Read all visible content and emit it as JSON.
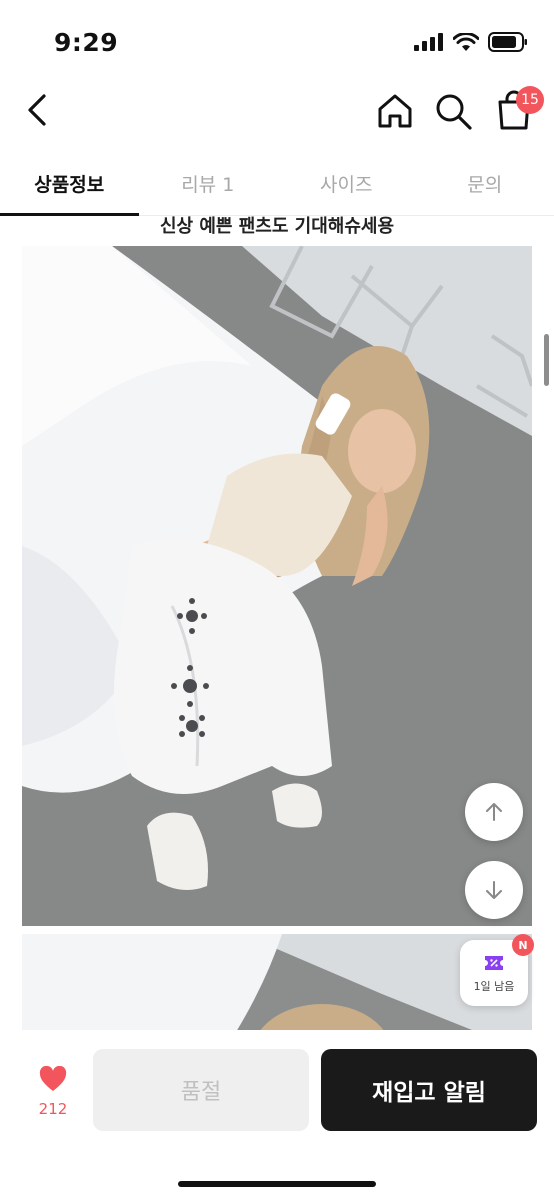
{
  "status": {
    "time": "9:29"
  },
  "nav": {
    "cart_badge": "15"
  },
  "tabs": [
    {
      "label": "상품정보"
    },
    {
      "label": "리뷰 1"
    },
    {
      "label": "사이즈"
    },
    {
      "label": "문의"
    }
  ],
  "product": {
    "title": "신상 예쁜 팬츠도 기대해슈세용"
  },
  "coupon": {
    "badge": "N",
    "label": "1일 남음"
  },
  "bottom": {
    "like_count": "212",
    "soldout_label": "품절",
    "restock_label": "재입고 알림"
  },
  "colors": {
    "accent": "#f2555b",
    "dark_button": "#1a1a1a",
    "coupon": "#8a3ff0"
  }
}
